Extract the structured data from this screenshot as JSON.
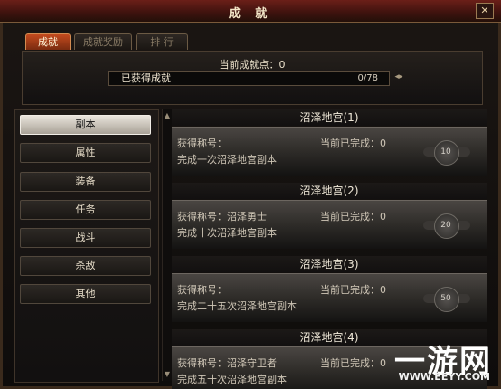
{
  "window": {
    "title": "成 就",
    "close": "✕"
  },
  "tabs": [
    {
      "label": "成就",
      "active": true
    },
    {
      "label": "成就奖励",
      "active": false
    },
    {
      "label": "排 行",
      "active": false
    }
  ],
  "summary": {
    "points": "当前成就点：0",
    "bar_label": "已获得成就",
    "bar_value": "0/78",
    "progress": 0,
    "arrow": "◂▸"
  },
  "sidebar": [
    "副本",
    "属性",
    "装备",
    "任务",
    "战斗",
    "杀敌",
    "其他"
  ],
  "scroll": {
    "up": "▲",
    "down": "▼"
  },
  "achievements": [
    {
      "name": "沼泽地宫(1)",
      "title": "获得称号：",
      "progress": "当前已完成：0",
      "desc": "完成一次沼泽地宫副本",
      "medal": "10"
    },
    {
      "name": "沼泽地宫(2)",
      "title": "获得称号：沼泽勇士",
      "progress": "当前已完成：0",
      "desc": "完成十次沼泽地宫副本",
      "medal": "20"
    },
    {
      "name": "沼泽地宫(3)",
      "title": "获得称号：",
      "progress": "当前已完成：0",
      "desc": "完成二十五次沼泽地宫副本",
      "medal": "50"
    },
    {
      "name": "沼泽地宫(4)",
      "title": "获得称号：沼泽守卫者",
      "progress": "当前已完成：0",
      "desc": "完成五十次沼泽地宫副本",
      "medal": ""
    }
  ],
  "watermark": {
    "brand": "一游网",
    "url": "WWW.EEYY.COM"
  },
  "colors": {
    "accent": "#c44b1e",
    "bar_fill": "#ffb04a"
  }
}
